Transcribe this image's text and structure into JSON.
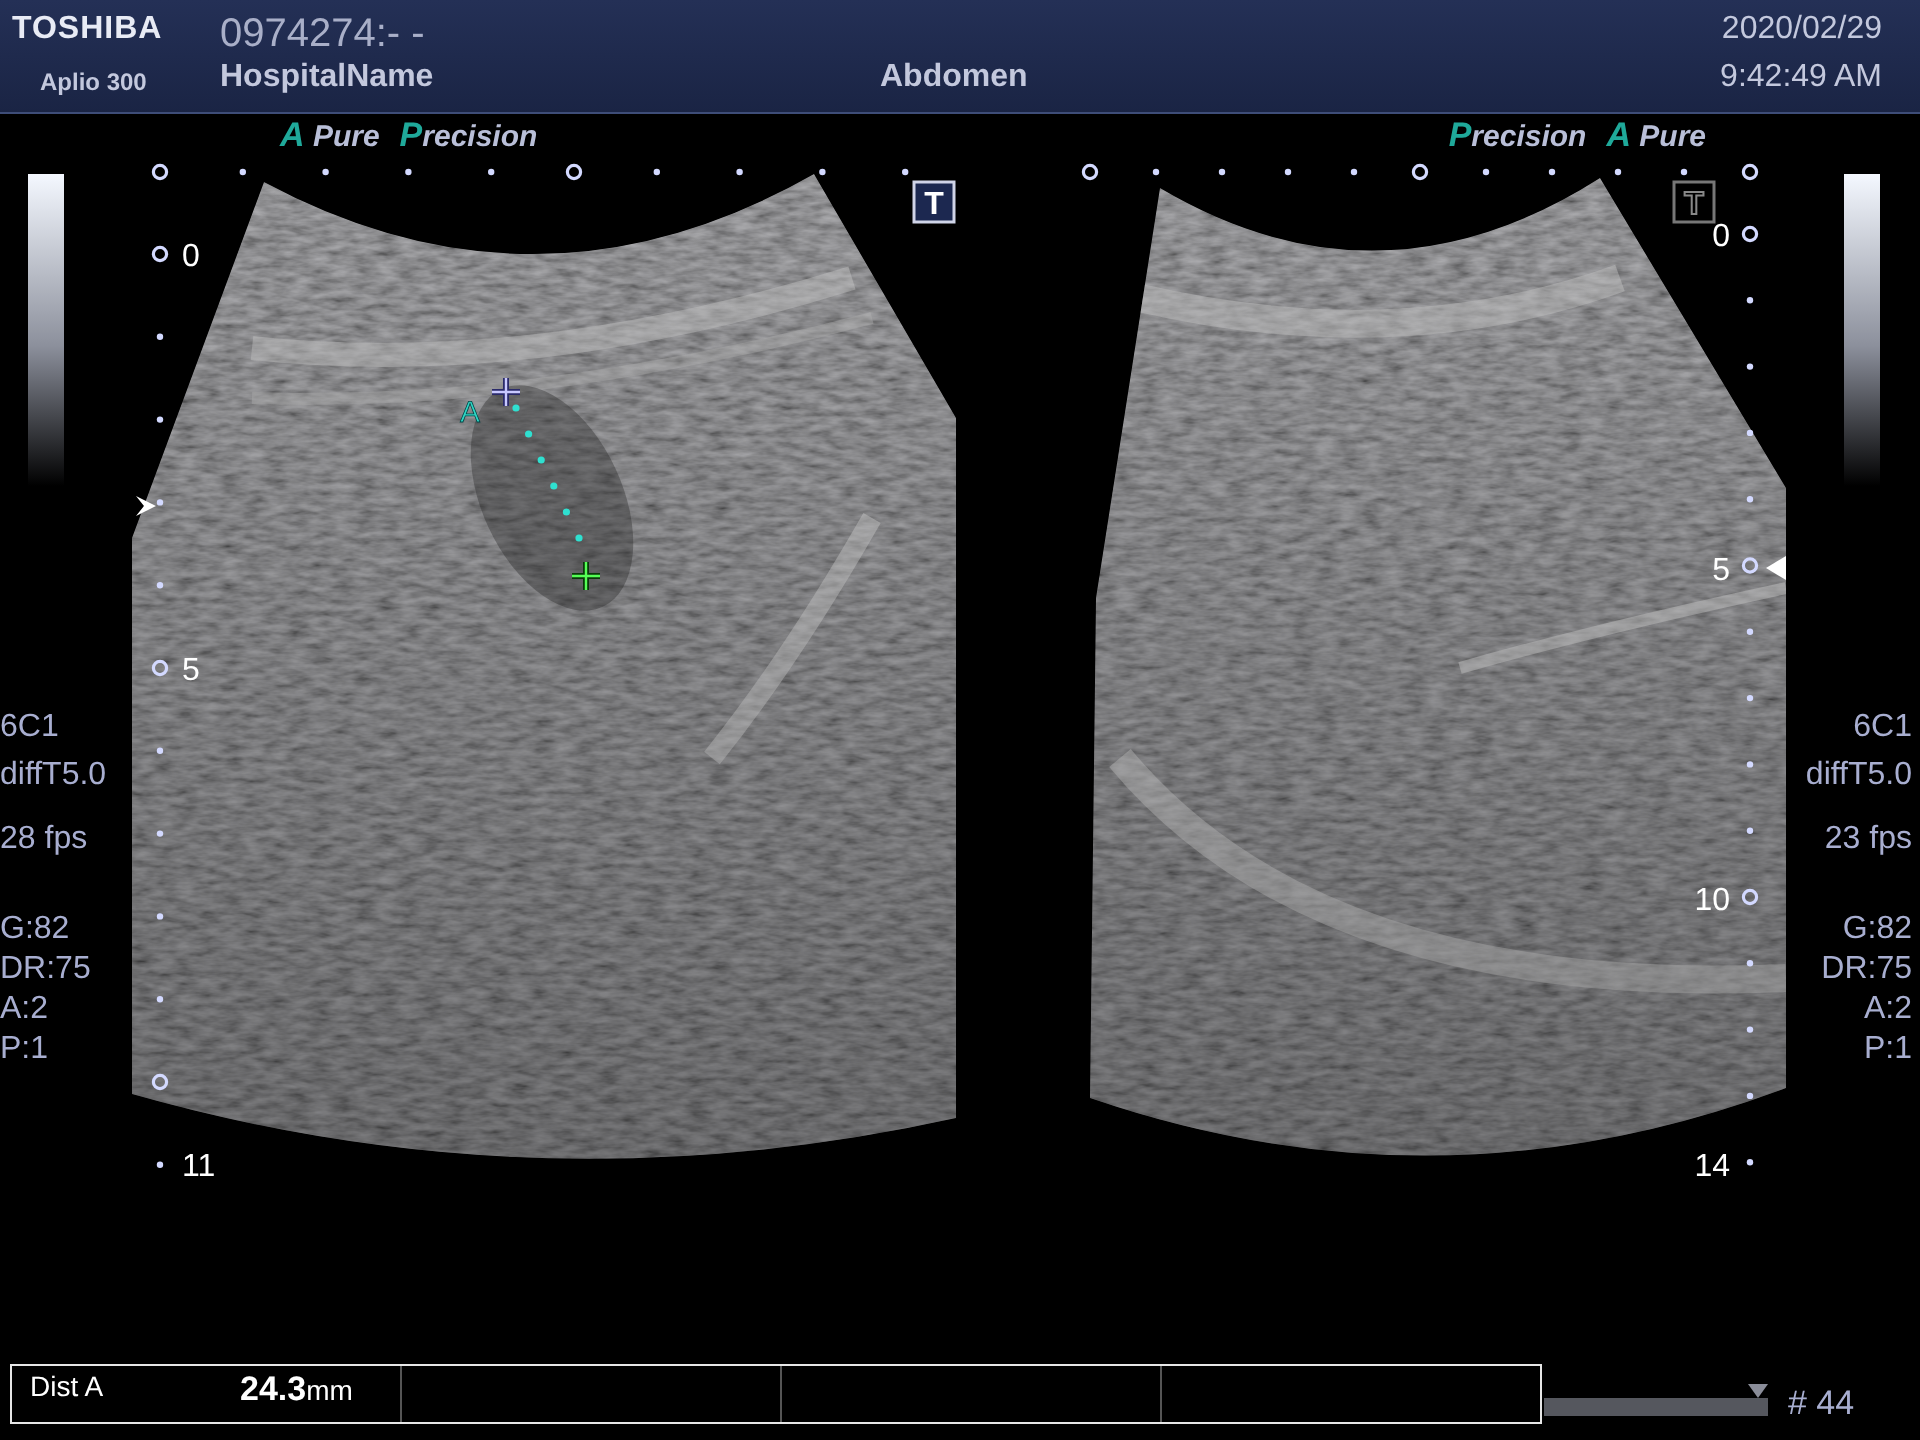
{
  "header": {
    "brand": "TOSHIBA",
    "model": "Aplio 300",
    "patient_id": "0974274:- -",
    "hospital": "HospitalName",
    "exam": "Abdomen",
    "date": "2020/02/29",
    "time": "9:42:49 AM"
  },
  "panels": [
    {
      "logos": [
        "A Pure",
        "Precision"
      ],
      "body_mark": {
        "text": "T",
        "selected": true
      },
      "depth_labels": [
        "0",
        "5",
        "11"
      ],
      "caliper": {
        "label": "A"
      },
      "params": {
        "probe": "6C1",
        "mode": "diffT5.0",
        "frame_rate": "28 fps",
        "settings": [
          "G:82",
          "DR:75",
          "A:2",
          "P:1"
        ]
      }
    },
    {
      "logos": [
        "Precision",
        "A Pure"
      ],
      "body_mark": {
        "text": "T",
        "selected": false
      },
      "depth_labels": [
        "0",
        "5",
        "10",
        "14"
      ],
      "params": {
        "probe": "6C1",
        "mode": "diffT5.0",
        "frame_rate": "23 fps",
        "settings": [
          "G:82",
          "DR:75",
          "A:2",
          "P:1"
        ]
      }
    }
  ],
  "measurement": {
    "label": "Dist A",
    "value": "24.3",
    "unit": "mm"
  },
  "cine": {
    "level": 1.0,
    "frame": "# 44"
  }
}
